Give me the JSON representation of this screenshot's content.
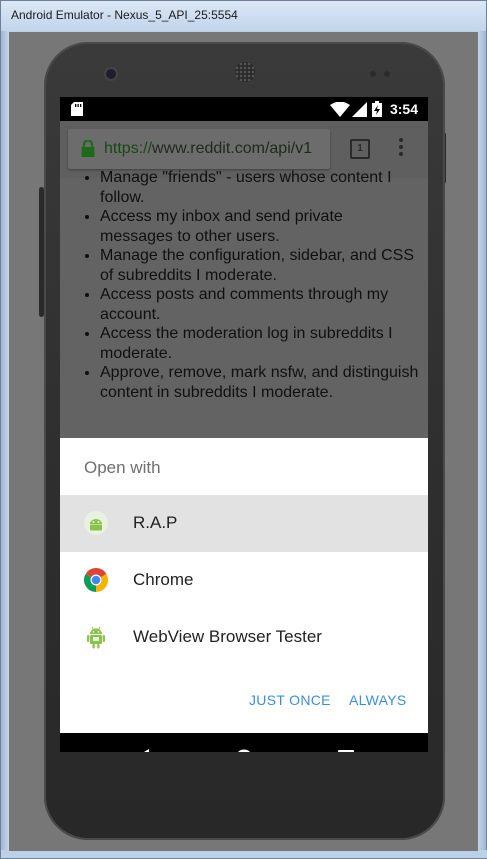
{
  "window": {
    "title": "Android Emulator - Nexus_5_API_25:5554"
  },
  "status_bar": {
    "time": "3:54",
    "icons": [
      "sd-card-icon",
      "wifi-icon",
      "signal-icon",
      "battery-charging-icon"
    ]
  },
  "browser": {
    "url_scheme": "https://",
    "url_rest": "www.reddit.com/api/v1",
    "tab_count": "1",
    "menu_icon": "overflow-menu-icon"
  },
  "page_list": [
    "Manage \"friends\" - users whose content I follow.",
    "Access my inbox and send private messages to other users.",
    "Manage the configuration, sidebar, and CSS of subreddits I moderate.",
    "Access posts and comments through my account.",
    "Access the moderation log in subreddits I moderate.",
    "Approve, remove, mark nsfw, and distinguish content in subreddits I moderate."
  ],
  "dialog": {
    "heading": "Open with",
    "apps": [
      {
        "label": "R.A.P",
        "icon": "android-app-icon",
        "selected": true
      },
      {
        "label": "Chrome",
        "icon": "chrome-icon",
        "selected": false
      },
      {
        "label": "WebView Browser Tester",
        "icon": "android-robot-icon",
        "selected": false
      }
    ],
    "just_once": "JUST ONCE",
    "always": "ALWAYS"
  },
  "colors": {
    "accent": "#3f8dd8",
    "lock_green": "#1e6a1a",
    "selected_row": "#e2e2e2"
  }
}
